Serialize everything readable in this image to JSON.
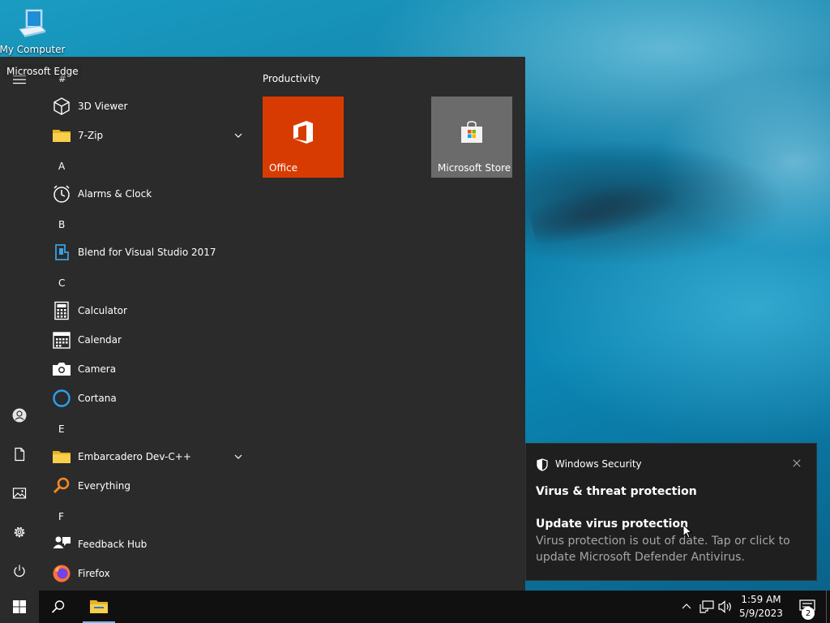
{
  "desktop": {
    "icons": [
      {
        "label": "My Computer",
        "icon": "computer-icon"
      },
      {
        "label": "Microsoft Edge",
        "icon": "edge-icon"
      }
    ]
  },
  "start_menu": {
    "rail": {
      "menu": "hamburger-icon",
      "account": "user-icon",
      "documents": "document-icon",
      "pictures": "pictures-icon",
      "settings": "gear-icon",
      "power": "power-icon"
    },
    "apps": {
      "headers": {
        "hash": "#",
        "a": "A",
        "b": "B",
        "c": "C",
        "e": "E",
        "f": "F"
      },
      "items": {
        "viewer3d": "3D Viewer",
        "zip": "7-Zip",
        "alarms": "Alarms & Clock",
        "blend": "Blend for Visual Studio 2017",
        "calculator": "Calculator",
        "calendar": "Calendar",
        "camera": "Camera",
        "cortana": "Cortana",
        "devcpp": "Embarcadero Dev-C++",
        "everything": "Everything",
        "feedback": "Feedback Hub",
        "firefox": "Firefox"
      }
    },
    "tiles": {
      "group_title": "Productivity",
      "office": {
        "label": "Office",
        "color": "#d83b01"
      },
      "store": {
        "label": "Microsoft Store",
        "color": "#6b6b6b"
      }
    }
  },
  "notification": {
    "source": "Windows Security",
    "title": "Virus & threat protection",
    "subtitle": "Update virus protection",
    "body": "Virus protection is out of date. Tap or click to update Microsoft Defender Antivirus."
  },
  "taskbar": {
    "time": "1:59 AM",
    "date": "5/9/2023",
    "notification_count": "2"
  },
  "colors": {
    "start_bg": "#2b2b2b",
    "taskbar_bg": "#101010",
    "toast_bg": "#1f1f1f",
    "accent": "#0078d7"
  }
}
